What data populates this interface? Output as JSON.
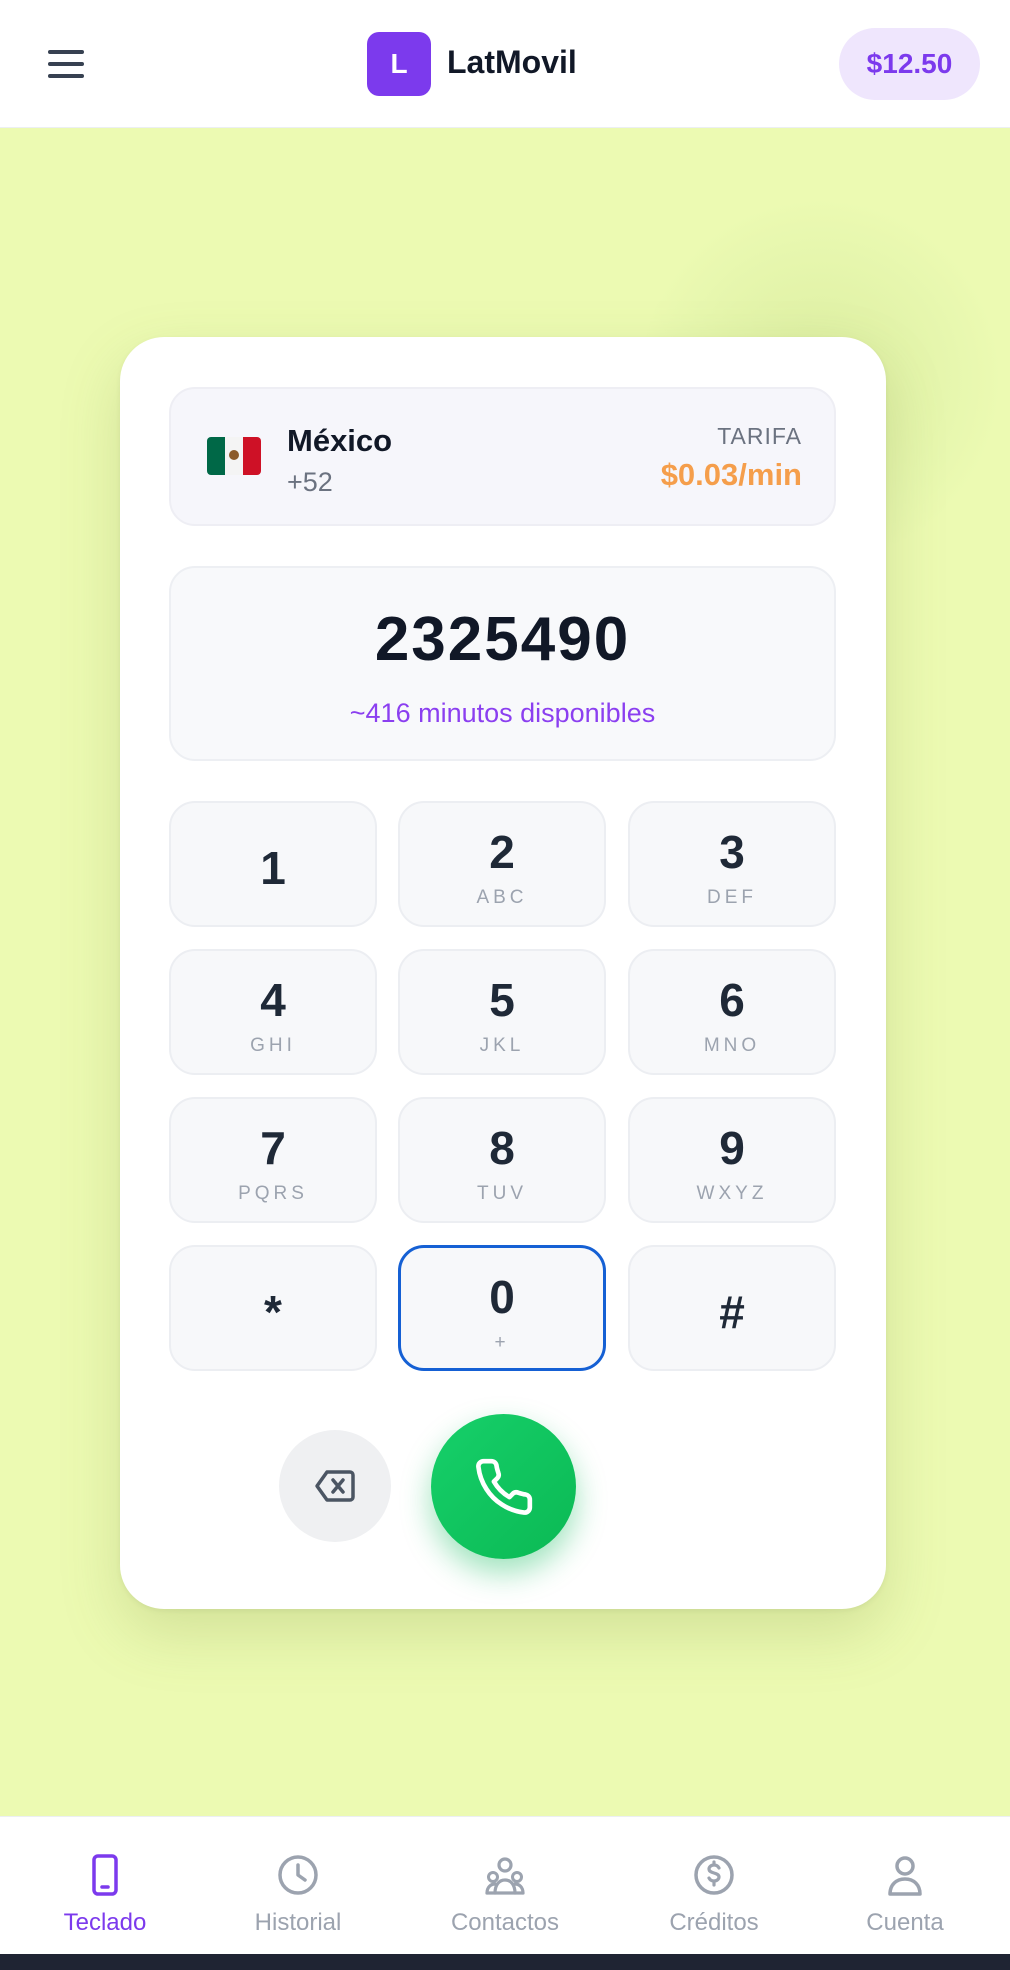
{
  "header": {
    "menu_icon": "menu-icon",
    "logo_letter": "L",
    "app_name": "LatMovil",
    "balance": "$12.50"
  },
  "country": {
    "flag": "mexico-flag-icon",
    "name": "México",
    "code": "+52",
    "rate_label": "TARIFA",
    "rate_value": "$0.03/min"
  },
  "display": {
    "number": "2325490",
    "minutes": "~416 minutos disponibles"
  },
  "keypad": [
    {
      "digit": "1",
      "letters": ""
    },
    {
      "digit": "2",
      "letters": "ABC"
    },
    {
      "digit": "3",
      "letters": "DEF"
    },
    {
      "digit": "4",
      "letters": "GHI"
    },
    {
      "digit": "5",
      "letters": "JKL"
    },
    {
      "digit": "6",
      "letters": "MNO"
    },
    {
      "digit": "7",
      "letters": "PQRS"
    },
    {
      "digit": "8",
      "letters": "TUV"
    },
    {
      "digit": "9",
      "letters": "WXYZ"
    },
    {
      "digit": "*",
      "letters": ""
    },
    {
      "digit": "0",
      "letters": "+"
    },
    {
      "digit": "#",
      "letters": ""
    }
  ],
  "focused_key": "0",
  "actions": {
    "backspace_icon": "backspace-icon",
    "call_icon": "phone-icon"
  },
  "nav": [
    {
      "label": "Teclado",
      "icon": "phone-device-icon",
      "active": true
    },
    {
      "label": "Historial",
      "icon": "clock-icon",
      "active": false
    },
    {
      "label": "Contactos",
      "icon": "contacts-icon",
      "active": false
    },
    {
      "label": "Créditos",
      "icon": "dollar-icon",
      "active": false
    },
    {
      "label": "Cuenta",
      "icon": "user-icon",
      "active": false
    }
  ],
  "colors": {
    "accent": "#7c3aed",
    "background": "#ecfab2",
    "call_green": "#16d06a",
    "rate_orange": "#f59e4b",
    "focus_blue": "#1560d4"
  }
}
